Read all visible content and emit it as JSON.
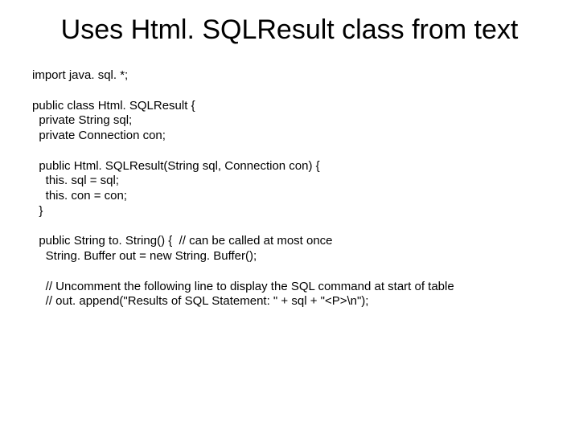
{
  "title": "Uses Html. SQLResult class from text",
  "code_lines": [
    "import java. sql. *;",
    "",
    "public class Html. SQLResult {",
    "  private String sql;",
    "  private Connection con;",
    "",
    "  public Html. SQLResult(String sql, Connection con) {",
    "    this. sql = sql;",
    "    this. con = con;",
    "  }",
    "",
    "  public String to. String() {  // can be called at most once",
    "    String. Buffer out = new String. Buffer();",
    "",
    "    // Uncomment the following line to display the SQL command at start of table",
    "    // out. append(\"Results of SQL Statement: \" + sql + \"<P>\\n\");"
  ]
}
